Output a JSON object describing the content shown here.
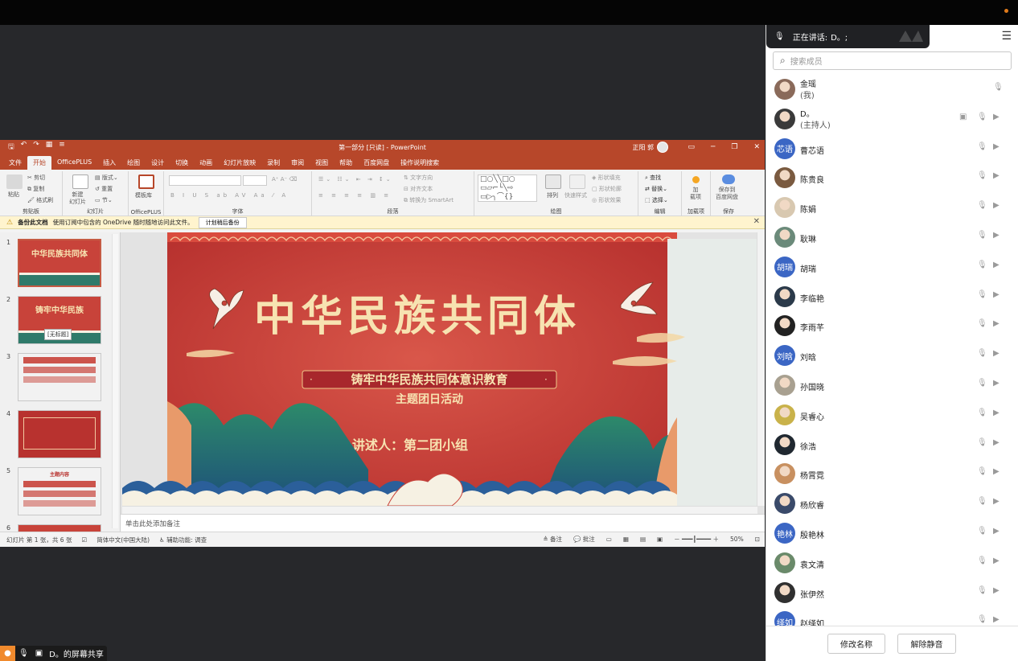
{
  "ppt": {
    "title": "第一部分 [只读] - PowerPoint",
    "user_name": "正阳 郭",
    "tabs": [
      "文件",
      "开始",
      "OfficePLUS",
      "插入",
      "绘图",
      "设计",
      "切换",
      "动画",
      "幻灯片放映",
      "录制",
      "审阅",
      "视图",
      "帮助",
      "百度网盘",
      "操作说明搜索"
    ],
    "active_tab": "开始",
    "ribbon_groups": [
      "剪贴板",
      "幻灯片",
      "OfficePLUS",
      "字体",
      "段落",
      "绘图",
      "编辑",
      "加载项",
      "保存"
    ],
    "ribbon_buttons": {
      "paste": "粘贴",
      "cut": "剪切",
      "copy": "复制",
      "format_painter": "格式刷",
      "new_slide": "新建\n幻灯片",
      "layout": "版式",
      "reset": "重置",
      "section": "节",
      "template": "模板库",
      "text_direction": "文字方向",
      "align_text": "对齐文本",
      "smartart": "转换为 SmartArt",
      "arrange": "排列",
      "quick_styles": "快速样式",
      "shape_fill": "形状填充",
      "shape_outline": "形状轮廓",
      "shape_effects": "形状效果",
      "find": "查找",
      "replace": "替换",
      "select": "选择",
      "addins": "加\n载项",
      "baidu_save": "保存到\n百度网盘"
    },
    "info": {
      "bold": "备份此文档",
      "text": "使用订阅中包含的 OneDrive 随时随地访问此文件。",
      "button": "计划稍后备份"
    },
    "slide": {
      "main_title": "中华民族共同体",
      "subtitle_line1": "铸牢中华民族共同体意识教育",
      "subtitle_line2": "主题团日活动",
      "presenter": "讲述人：第二团小组",
      "accent": "#c8433a",
      "gold": "#f7e3b1"
    },
    "thumbnails": [
      {
        "num": "1",
        "title": "中华民族共同体"
      },
      {
        "num": "2",
        "title": "铸牢中华民族",
        "tooltip": "[无标题]"
      },
      {
        "num": "3",
        "title": ""
      },
      {
        "num": "4",
        "title": ""
      },
      {
        "num": "5",
        "title": "主题内容"
      },
      {
        "num": "6",
        "title": ""
      }
    ],
    "notes_placeholder": "单击此处添加备注",
    "status": {
      "slide": "幻灯片 第 1 张，共 6 张",
      "lang": "简体中文(中国大陆)",
      "access": "辅助功能: 调查",
      "notes": "备注",
      "comments": "批注",
      "zoom": "50%"
    }
  },
  "share_label": "D。的屏幕共享",
  "panel": {
    "speaking_label": "正在讲话:",
    "speaking_name": "D。;",
    "search_placeholder": "搜索成员",
    "members": [
      {
        "name": "金瑶",
        "sub": "(我)",
        "avatar": "photo",
        "color": "#8a6a5a"
      },
      {
        "name": "D。",
        "sub": "(主持人)",
        "avatar": "photo",
        "color": "#3a3a3a"
      },
      {
        "name": "曹芯语",
        "avatar_text": "芯语",
        "avatar": "text"
      },
      {
        "name": "陈贵良",
        "avatar": "photo",
        "color": "#7a5a40"
      },
      {
        "name": "陈娟",
        "avatar": "photo",
        "color": "#d8c8b0"
      },
      {
        "name": "耿琳",
        "avatar": "photo",
        "color": "#6b8a7a"
      },
      {
        "name": "胡瑞",
        "avatar_text": "胡瑞",
        "avatar": "text"
      },
      {
        "name": "李临艳",
        "avatar": "photo",
        "color": "#2b3a4a"
      },
      {
        "name": "李雨芊",
        "avatar": "photo",
        "color": "#222222"
      },
      {
        "name": "刘晗",
        "avatar_text": "刘晗",
        "avatar": "text"
      },
      {
        "name": "孙国晓",
        "avatar": "photo",
        "color": "#a8a090"
      },
      {
        "name": "吴睿心",
        "avatar": "photo",
        "color": "#c9b24a"
      },
      {
        "name": "徐浩",
        "avatar": "photo",
        "color": "#202830"
      },
      {
        "name": "杨霄霓",
        "avatar": "photo",
        "color": "#c89060"
      },
      {
        "name": "杨欣睿",
        "avatar": "photo",
        "color": "#3a4a6a"
      },
      {
        "name": "殷艳林",
        "avatar_text": "艳林",
        "avatar": "text"
      },
      {
        "name": "袁文清",
        "avatar": "photo",
        "color": "#6a8a6a"
      },
      {
        "name": "张伊然",
        "avatar": "photo",
        "color": "#303030"
      },
      {
        "name": "赵绎如",
        "avatar_text": "绎如",
        "avatar": "text"
      }
    ],
    "btn_rename": "修改名称",
    "btn_unmute": "解除静音"
  }
}
